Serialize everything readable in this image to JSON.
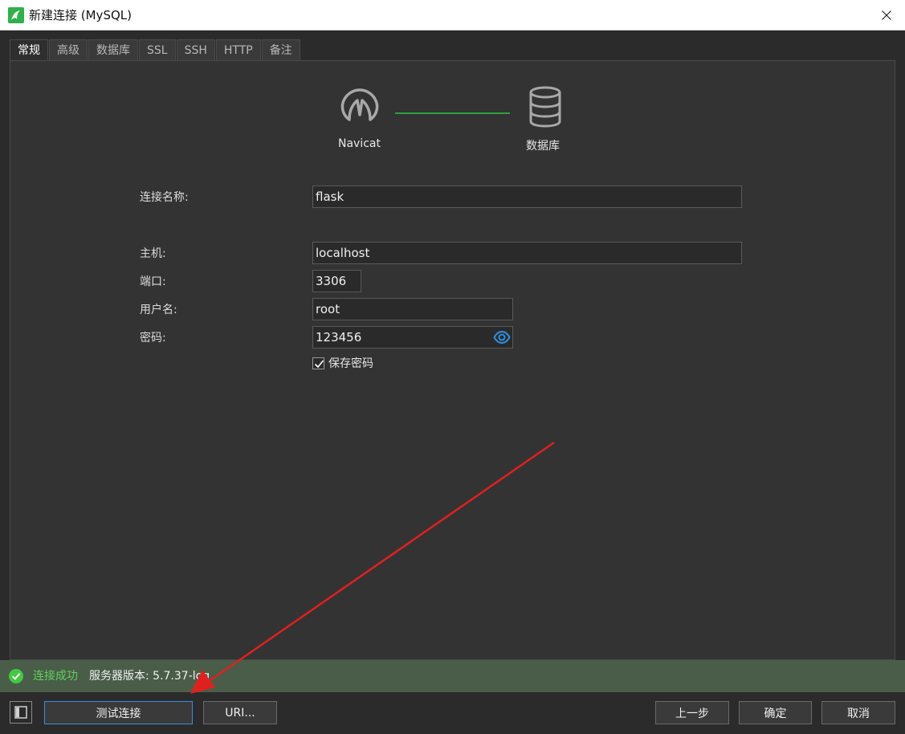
{
  "window": {
    "title": "新建连接 (MySQL)"
  },
  "tabs": [
    {
      "label": "常规",
      "active": true
    },
    {
      "label": "高级",
      "active": false
    },
    {
      "label": "数据库",
      "active": false
    },
    {
      "label": "SSL",
      "active": false
    },
    {
      "label": "SSH",
      "active": false
    },
    {
      "label": "HTTP",
      "active": false
    },
    {
      "label": "备注",
      "active": false
    }
  ],
  "diagram": {
    "left_label": "Navicat",
    "right_label": "数据库",
    "line_color": "#2ea043"
  },
  "form": {
    "connection_name": {
      "label": "连接名称:",
      "value": "flask"
    },
    "host": {
      "label": "主机:",
      "value": "localhost"
    },
    "port": {
      "label": "端口:",
      "value": "3306"
    },
    "username": {
      "label": "用户名:",
      "value": "root"
    },
    "password": {
      "label": "密码:",
      "value": "123456"
    },
    "save_password": {
      "label": "保存密码",
      "checked": true
    }
  },
  "status": {
    "success_text": "连接成功",
    "server_text": "服务器版本: 5.7.37-log",
    "success_color": "#5fd35f"
  },
  "buttons": {
    "test_connection": "测试连接",
    "uri": "URI...",
    "back": "上一步",
    "ok": "确定",
    "cancel": "取消"
  },
  "colors": {
    "accent": "#3b8fd9",
    "annotation": "#e02020"
  }
}
